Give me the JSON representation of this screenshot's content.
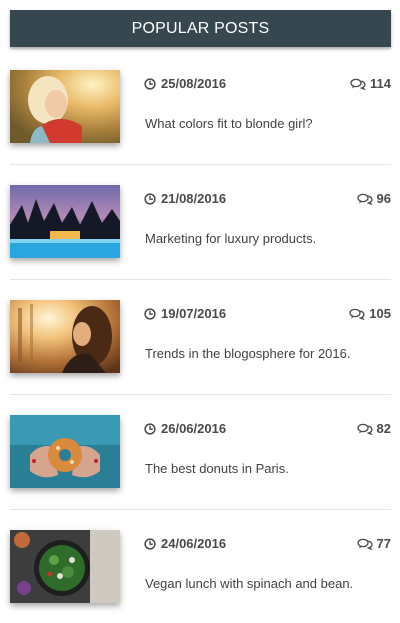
{
  "widget": {
    "title": "POPULAR POSTS",
    "header_color": "#37474f"
  },
  "posts": [
    {
      "date": "25/08/2016",
      "comments": "114",
      "title": "What colors fit to blonde girl?",
      "thumbnail": "blonde-girl-photo"
    },
    {
      "date": "21/08/2016",
      "comments": "96",
      "title": "Marketing for luxury products.",
      "thumbnail": "pool-palms-dusk-photo"
    },
    {
      "date": "19/07/2016",
      "comments": "105",
      "title": "Trends in the blogosphere for 2016.",
      "thumbnail": "woman-sunlight-photo"
    },
    {
      "date": "26/06/2016",
      "comments": "82",
      "title": "The best donuts in Paris.",
      "thumbnail": "donut-hands-photo"
    },
    {
      "date": "24/06/2016",
      "comments": "77",
      "title": "Vegan lunch with spinach and bean.",
      "thumbnail": "spinach-dish-photo"
    }
  ],
  "icons": {
    "date": "clock-icon",
    "comments": "comments-icon"
  }
}
